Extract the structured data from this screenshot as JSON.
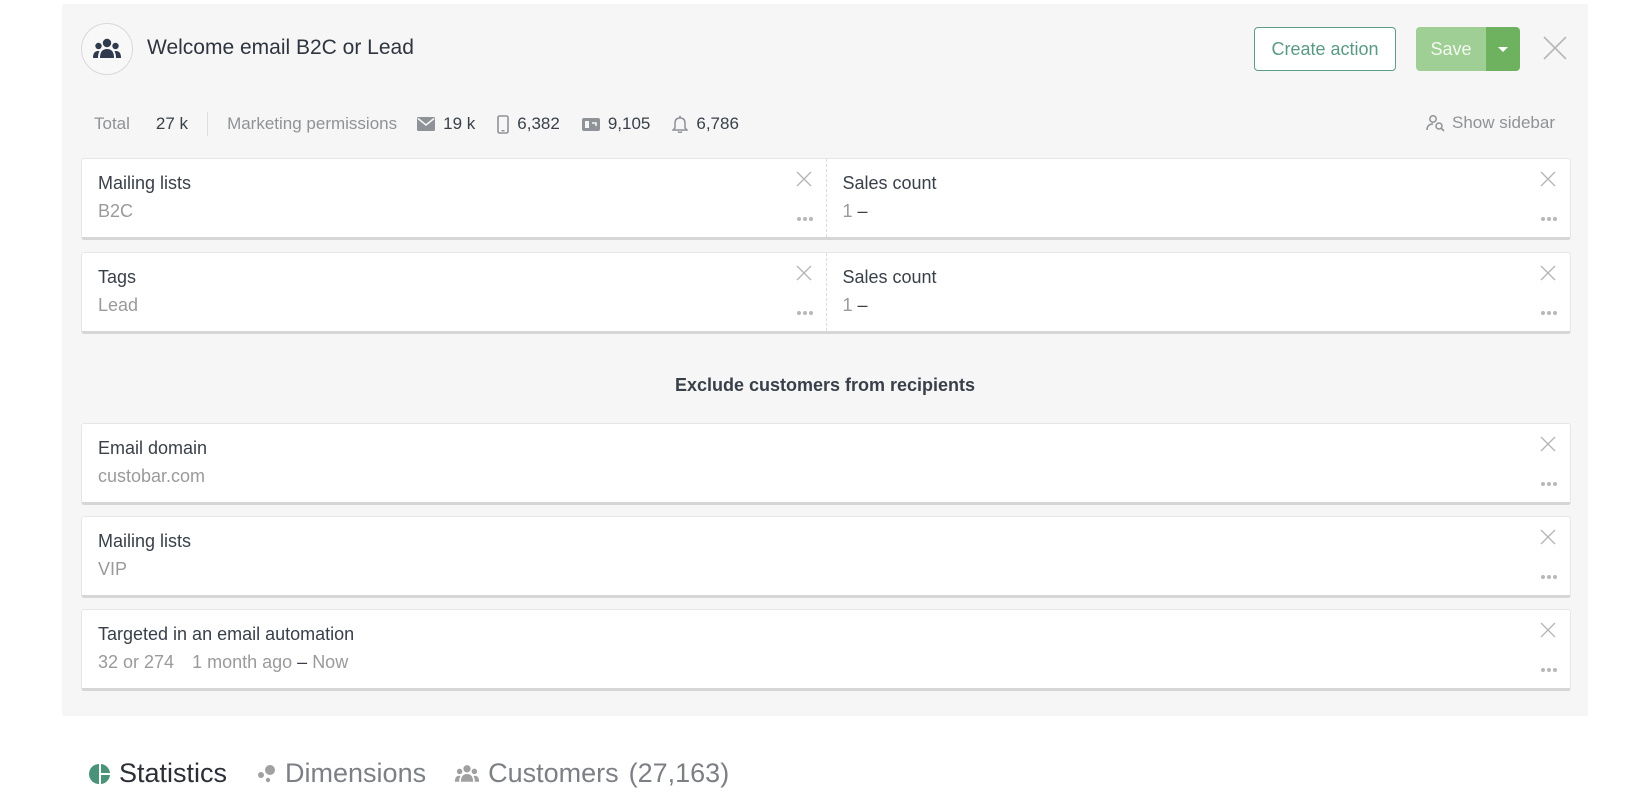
{
  "header": {
    "title": "Welcome email B2C or Lead",
    "avatar_icon": "users-group-icon",
    "create_action_label": "Create action",
    "save_label": "Save",
    "save_dropdown_icon": "caret-down-icon",
    "close_icon": "close-icon"
  },
  "stats": {
    "total_label": "Total",
    "total_value": "27 k",
    "permissions_label": "Marketing permissions",
    "items": [
      {
        "icon": "email-icon",
        "value": "19 k"
      },
      {
        "icon": "mobile-icon",
        "value": "6,382"
      },
      {
        "icon": "mailbox-icon",
        "value": "9,105"
      },
      {
        "icon": "bell-icon",
        "value": "6,786"
      }
    ],
    "show_sidebar_label": "Show sidebar",
    "show_sidebar_icon": "user-search-icon"
  },
  "include_rules": [
    {
      "left": {
        "title": "Mailing lists",
        "value": "B2C"
      },
      "right": {
        "title": "Sales count",
        "value": "1",
        "suffix": "–"
      }
    },
    {
      "left": {
        "title": "Tags",
        "value": "Lead"
      },
      "right": {
        "title": "Sales count",
        "value": "1",
        "suffix": "–"
      }
    }
  ],
  "exclude_heading": "Exclude customers from recipients",
  "exclude_rules": [
    {
      "title": "Email domain",
      "value": "custobar.com"
    },
    {
      "title": "Mailing lists",
      "value": "VIP"
    },
    {
      "title": "Targeted in an email automation",
      "value": "32 or 274",
      "range_from": "1 month ago",
      "range_sep": "–",
      "range_to": "Now"
    }
  ],
  "tabs": [
    {
      "label": "Statistics",
      "icon": "pie-chart-icon",
      "active": true
    },
    {
      "label": "Dimensions",
      "icon": "dimensions-icon",
      "active": false
    },
    {
      "label": "Customers",
      "icon": "users-group-icon",
      "count": "(27,163)",
      "active": false
    }
  ],
  "colors": {
    "accent": "#5a9a84",
    "save_bg": "#9fcf94",
    "save_dropdown_bg": "#6eb25f",
    "panel_bg": "#f6f6f6"
  }
}
